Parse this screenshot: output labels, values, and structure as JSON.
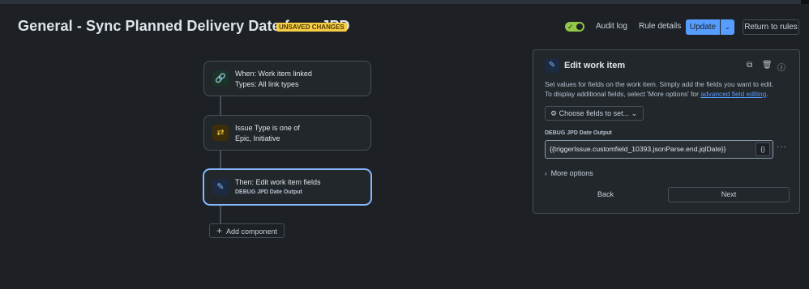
{
  "header": {
    "title": "General - Sync Planned Delivery Date from JPD",
    "badge": "UNSAVED CHANGES",
    "toggle_state": "on",
    "audit_log": "Audit log",
    "rule_details": "Rule details",
    "update": "Update",
    "return_to_rules": "Return to rules"
  },
  "flow": {
    "nodes": [
      {
        "icon": "link-icon",
        "line1": "When: Work item linked",
        "line2": "Types: All link types"
      },
      {
        "icon": "swap-icon",
        "line1": "Issue Type is one of",
        "line2": "Epic, Initiative"
      },
      {
        "icon": "edit-icon",
        "line1": "Then: Edit work item fields",
        "line2": "DEBUG JPD Date Output"
      }
    ],
    "add_component": "Add component"
  },
  "panel": {
    "title": "Edit work item",
    "description_1": "Set values for fields on the work item. Simply add the fields you want to edit.",
    "description_2": "To display additional fields, select 'More options' for ",
    "description_link": "advanced field editing",
    "description_end": ".",
    "choose_fields": "Choose fields to set...",
    "field_label": "DEBUG JPD Date Output",
    "field_value": "{{triggerIssue.customfield_10393.jsonParse.end.jqlDate}}",
    "brace_button": "{}",
    "more_options": "More options",
    "back": "Back",
    "next": "Next"
  },
  "colors": {
    "background": "#1d2125",
    "accent": "#579dff",
    "toggle": "#94c748",
    "badge": "#f5cd47"
  }
}
